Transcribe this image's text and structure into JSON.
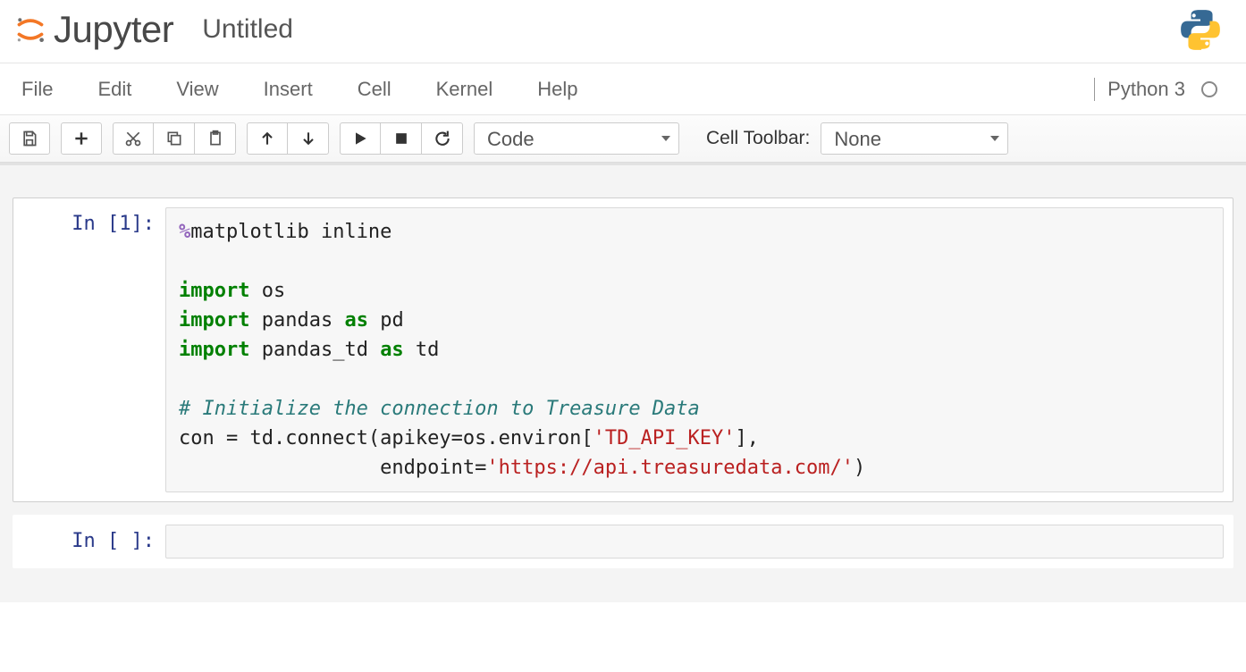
{
  "header": {
    "logo_text": "Jupyter",
    "title": "Untitled"
  },
  "menubar": {
    "items": [
      "File",
      "Edit",
      "View",
      "Insert",
      "Cell",
      "Kernel",
      "Help"
    ],
    "kernel_name": "Python 3"
  },
  "toolbar": {
    "cell_type_selected": "Code",
    "cell_toolbar_label": "Cell Toolbar:",
    "cell_toolbar_selected": "None"
  },
  "cells": [
    {
      "prompt": "In [1]:",
      "tokens": [
        {
          "class": "tok-magic",
          "text": "%"
        },
        {
          "class": "tok-normal",
          "text": "matplotlib inline\n\n"
        },
        {
          "class": "tok-keyword",
          "text": "import"
        },
        {
          "class": "tok-normal",
          "text": " os\n"
        },
        {
          "class": "tok-keyword",
          "text": "import"
        },
        {
          "class": "tok-normal",
          "text": " pandas "
        },
        {
          "class": "tok-keyword",
          "text": "as"
        },
        {
          "class": "tok-normal",
          "text": " pd\n"
        },
        {
          "class": "tok-keyword",
          "text": "import"
        },
        {
          "class": "tok-normal",
          "text": " pandas_td "
        },
        {
          "class": "tok-keyword",
          "text": "as"
        },
        {
          "class": "tok-normal",
          "text": " td\n\n"
        },
        {
          "class": "tok-comment",
          "text": "# Initialize the connection to Treasure Data"
        },
        {
          "class": "tok-normal",
          "text": "\ncon = td.connect(apikey=os.environ["
        },
        {
          "class": "tok-string",
          "text": "'TD_API_KEY'"
        },
        {
          "class": "tok-normal",
          "text": "],\n                 endpoint="
        },
        {
          "class": "tok-string",
          "text": "'https://api.treasuredata.com/'"
        },
        {
          "class": "tok-normal",
          "text": ")"
        }
      ]
    },
    {
      "prompt": "In [ ]:",
      "tokens": []
    }
  ]
}
